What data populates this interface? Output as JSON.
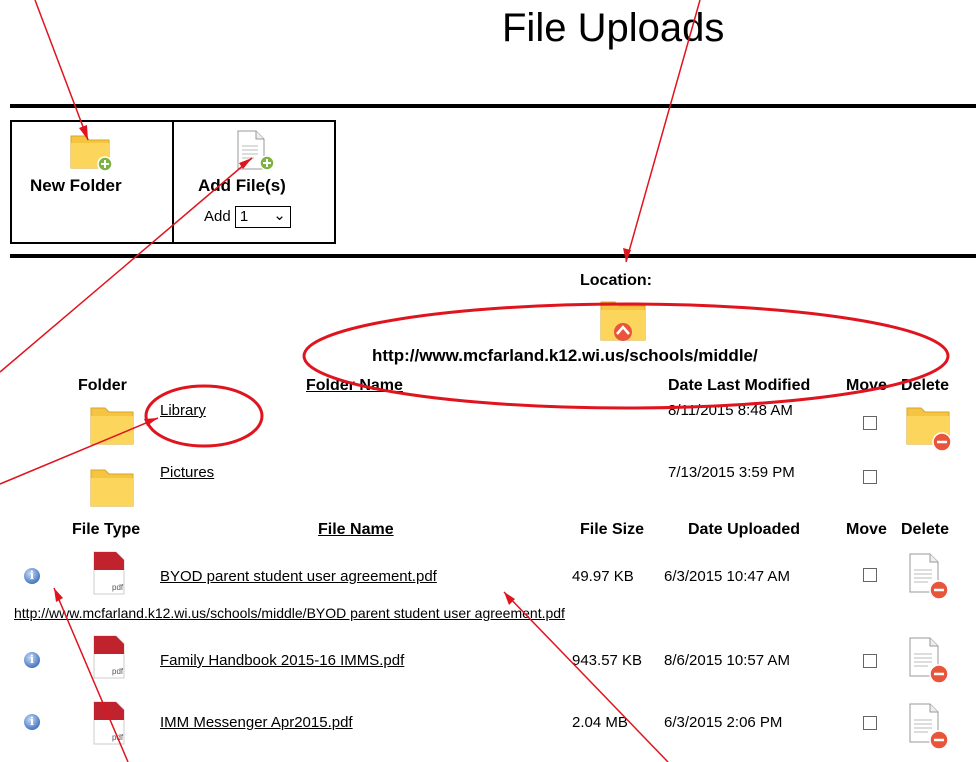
{
  "page": {
    "title": "File Uploads"
  },
  "toolbar": {
    "new_folder_label": "New Folder",
    "add_files_label": "Add File(s)",
    "add_prefix": "Add",
    "add_count_selected": "1"
  },
  "location": {
    "label": "Location:",
    "url": "http://www.mcfarland.k12.wi.us/schools/middle/"
  },
  "folders": {
    "headers": {
      "folder": "Folder",
      "folder_name": "Folder Name",
      "date_last_modified": "Date Last Modified",
      "move": "Move",
      "delete": "Delete"
    },
    "rows": [
      {
        "name": "Library",
        "modified": "8/11/2015 8:48 AM"
      },
      {
        "name": "Pictures",
        "modified": "7/13/2015 3:59 PM"
      }
    ]
  },
  "files": {
    "headers": {
      "file_type": "File Type",
      "file_name": "File Name",
      "file_size": "File Size",
      "date_uploaded": "Date Uploaded",
      "move": "Move",
      "delete": "Delete"
    },
    "rows": [
      {
        "name": "BYOD parent student user agreement.pdf",
        "size": "49.97 KB",
        "uploaded": "6/3/2015 10:47 AM",
        "type_label": "pdf"
      },
      {
        "name": "Family Handbook 2015-16 IMMS.pdf",
        "size": "943.57 KB",
        "uploaded": "8/6/2015 10:57 AM",
        "type_label": "pdf"
      },
      {
        "name": "IMM Messenger Apr2015.pdf",
        "size": "2.04 MB",
        "uploaded": "6/3/2015 2:06 PM",
        "type_label": "pdf"
      }
    ],
    "expanded_url": "http://www.mcfarland.k12.wi.us/schools/middle/BYOD parent student user agreement.pdf"
  },
  "icons": {
    "folder_color": "#f5c542",
    "add_badge_color": "#7cb342",
    "delete_badge_color": "#e8553a",
    "annotation_color": "#e0141e"
  }
}
